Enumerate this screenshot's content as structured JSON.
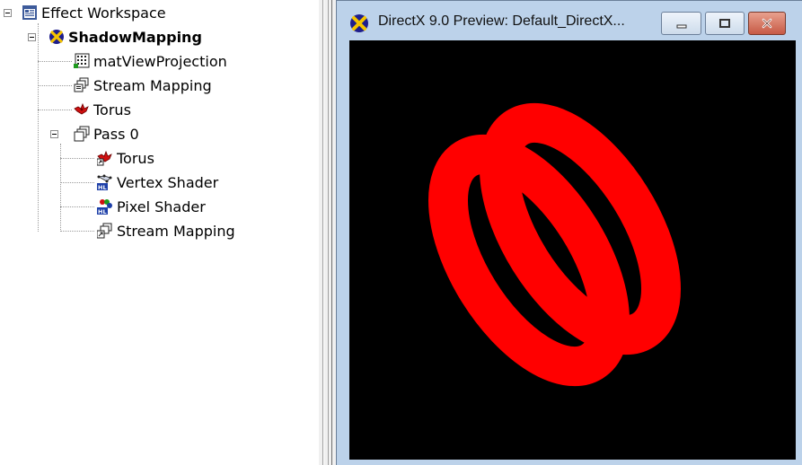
{
  "tree": {
    "root": {
      "label": "Effect Workspace",
      "icon": "workspace-icon"
    },
    "effect": {
      "label": "ShadowMapping",
      "icon": "directx-effect-icon"
    },
    "items": [
      {
        "label": "matViewProjection",
        "icon": "matrix-variable-icon"
      },
      {
        "label": "Stream Mapping",
        "icon": "stream-mapping-icon"
      },
      {
        "label": "Torus",
        "icon": "model-icon"
      }
    ],
    "pass": {
      "label": "Pass 0",
      "icon": "pass-icon",
      "children": [
        {
          "label": "Torus",
          "icon": "model-reference-icon"
        },
        {
          "label": "Vertex Shader",
          "icon": "vertex-shader-icon"
        },
        {
          "label": "Pixel Shader",
          "icon": "pixel-shader-icon"
        },
        {
          "label": "Stream Mapping",
          "icon": "stream-mapping-reference-icon"
        }
      ]
    }
  },
  "preview": {
    "title": "DirectX 9.0 Preview: Default_DirectX...",
    "icon": "directx-icon",
    "buttons": {
      "minimize": "minimize-icon",
      "maximize": "maximize-icon",
      "close": "close-icon"
    },
    "colors": {
      "background": "#000000",
      "model": "#ff0000"
    }
  }
}
